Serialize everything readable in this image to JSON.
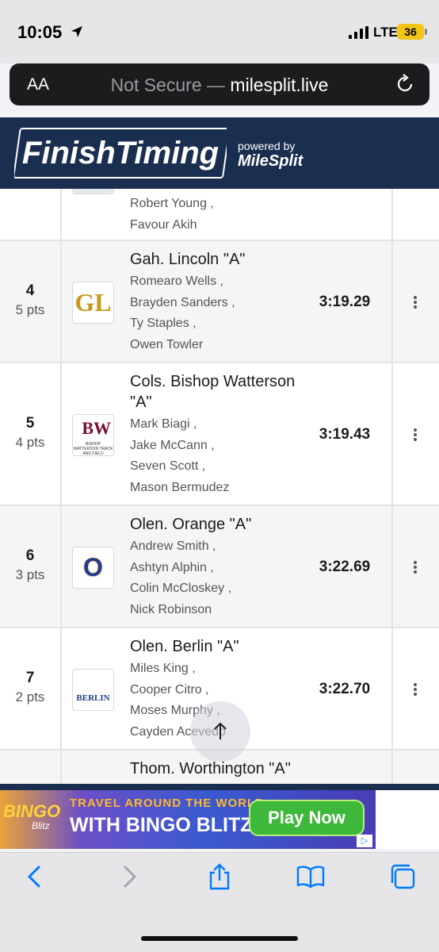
{
  "status_bar": {
    "time": "10:05",
    "network": "LTE",
    "battery": "36"
  },
  "address_bar": {
    "text_size_label": "AA",
    "security_label": "Not Secure —",
    "domain": "milesplit.live"
  },
  "header": {
    "logo_text": "FinishTiming",
    "powered_by": "powered by",
    "milesplit_text": "MileSplit"
  },
  "rows": [
    {
      "place": "",
      "points": "",
      "team": "",
      "runners": [
        "Robert Young ,",
        "Favour Akih"
      ],
      "time": ""
    },
    {
      "place": "4",
      "points": "5 pts",
      "team": "Gah. Lincoln \"A\"",
      "runners": [
        "Romearo Wells ,",
        "Brayden Sanders ,",
        "Ty Staples ,",
        "Owen Towler"
      ],
      "time": "3:19.29",
      "logo_text": "GL"
    },
    {
      "place": "5",
      "points": "4 pts",
      "team": "Cols. Bishop Watterson \"A\"",
      "runners": [
        "Mark Biagi ,",
        "Jake McCann ,",
        "Seven Scott ,",
        "Mason Bermudez"
      ],
      "time": "3:19.43",
      "logo_text": "BW",
      "logo_caption": "BISHOP WATTERSON TRACK AND FIELD"
    },
    {
      "place": "6",
      "points": "3 pts",
      "team": "Olen. Orange \"A\"",
      "runners": [
        "Andrew Smith ,",
        "Ashtyn Alphin ,",
        "Colin McCloskey ,",
        "Nick Robinson"
      ],
      "time": "3:22.69",
      "logo_text": "O"
    },
    {
      "place": "7",
      "points": "2 pts",
      "team": "Olen. Berlin \"A\"",
      "runners": [
        "Miles King ,",
        "Cooper Citro ,",
        "Moses Murphy ,",
        "Cayden Acevedo"
      ],
      "time": "3:22.70",
      "logo_text": "BERLIN"
    },
    {
      "place": "",
      "points": "",
      "team": "Thom. Worthington \"A\"",
      "runners": [],
      "time": ""
    }
  ],
  "ad": {
    "brand": "BINGO",
    "brand_sub": "Blitz",
    "line1": "TRAVEL AROUND THE WORLD",
    "line2": "WITH BINGO BLITZ",
    "cta": "Play Now"
  },
  "colors": {
    "header_navy": "#1a2e4f",
    "address_bar_bg": "#1c1c1e",
    "battery_yellow": "#f2c415",
    "play_green": "#3eb83a"
  },
  "toolbar": {
    "icons": [
      "back-icon",
      "forward-icon",
      "share-icon",
      "bookmarks-icon",
      "tabs-icon"
    ]
  }
}
